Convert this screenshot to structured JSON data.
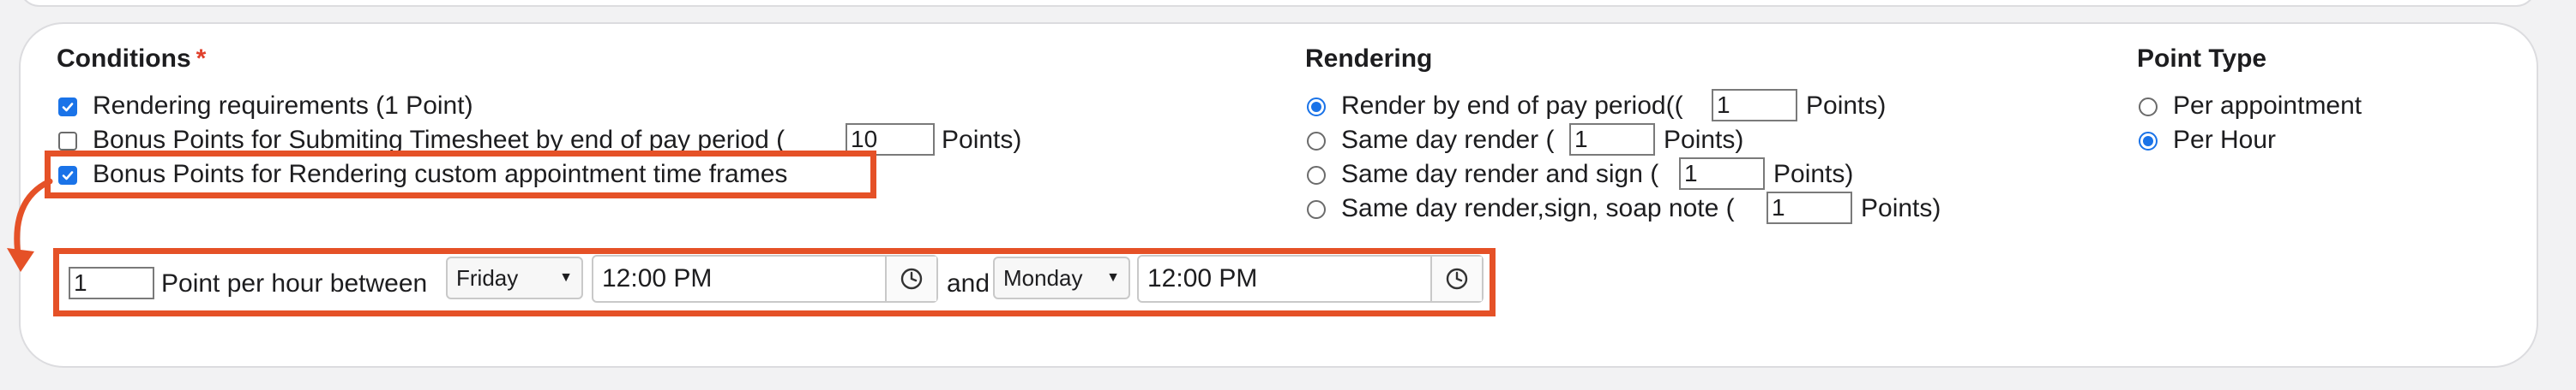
{
  "conditions": {
    "heading": "Conditions",
    "required_mark": "*",
    "items": [
      {
        "label": "Rendering requirements (1 Point)",
        "checked": true
      },
      {
        "label_before": "Bonus Points for Submiting Timesheet by end of pay period (",
        "points_value": "10",
        "label_after": "Points)",
        "checked": false
      },
      {
        "label": "Bonus Points for Rendering custom appointment time frames",
        "checked": true
      }
    ],
    "custom_timeframe": {
      "points_value": "1",
      "between_label": "Point per hour between",
      "start_day": "Friday",
      "start_time": "12:00 PM",
      "and_label": "and",
      "end_day": "Monday",
      "end_time": "12:00 PM"
    }
  },
  "rendering": {
    "heading": "Rendering",
    "options": [
      {
        "label_before": "Render by end of pay period((",
        "points_value": "1",
        "label_after": "Points)",
        "selected": true
      },
      {
        "label_before": "Same day render (",
        "points_value": "1",
        "label_after": "Points)",
        "selected": false
      },
      {
        "label_before": "Same day render and sign (",
        "points_value": "1",
        "label_after": "Points)",
        "selected": false
      },
      {
        "label_before": "Same day render,sign, soap note (",
        "points_value": "1",
        "label_after": "Points)",
        "selected": false
      }
    ]
  },
  "point_type": {
    "heading": "Point Type",
    "options": [
      {
        "label": "Per appointment",
        "selected": false
      },
      {
        "label": "Per Hour",
        "selected": true
      }
    ]
  },
  "annotation_color": "#e55127",
  "accent_color": "#1a73e8",
  "icons": [
    "checkmark-icon",
    "clock-icon",
    "chevron-down-icon",
    "curved-arrow-icon"
  ]
}
